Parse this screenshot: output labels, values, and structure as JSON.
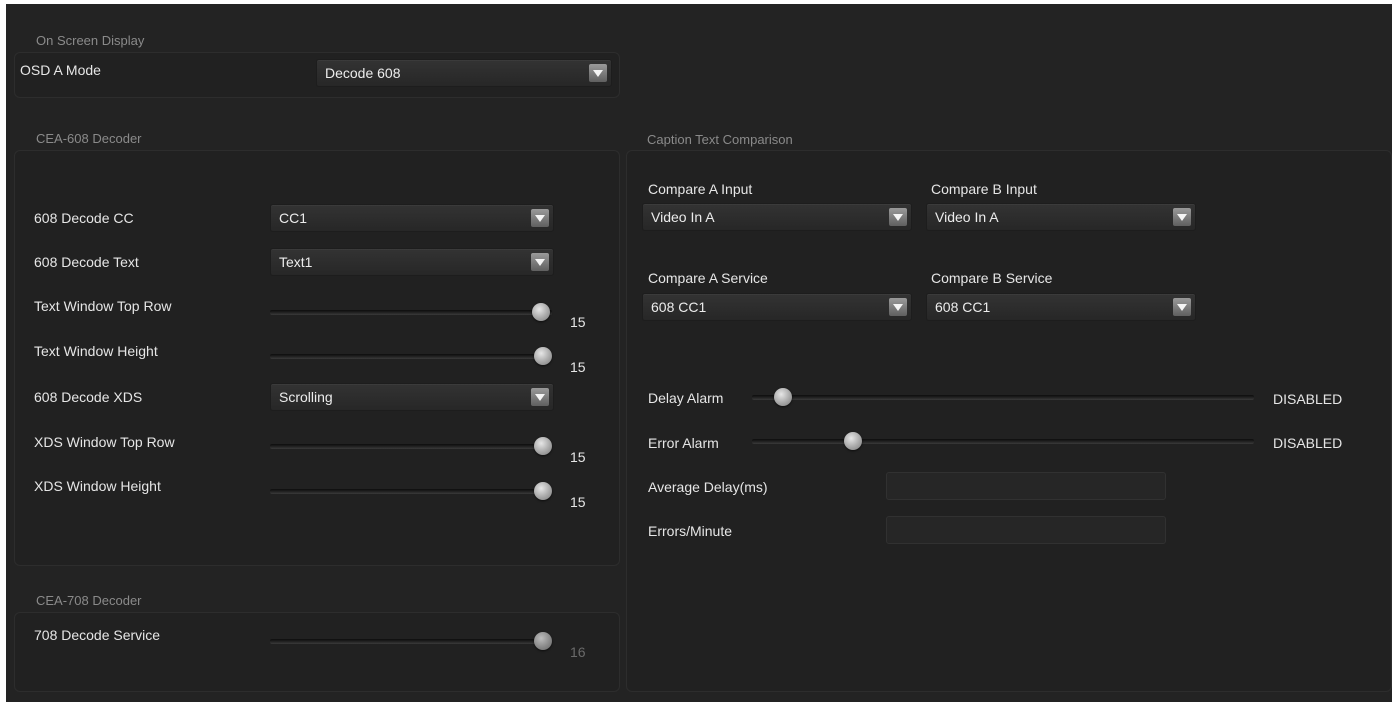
{
  "osd": {
    "title": "On Screen Display",
    "mode_label": "OSD A Mode",
    "mode_value": "Decode 608"
  },
  "cea608": {
    "title": "CEA-608 Decoder",
    "decode_cc_label": "608 Decode CC",
    "decode_cc_value": "CC1",
    "decode_text_label": "608 Decode Text",
    "decode_text_value": "Text1",
    "text_top_row_label": "Text Window Top Row",
    "text_top_row_value": "15",
    "text_height_label": "Text Window Height",
    "text_height_value": "15",
    "decode_xds_label": "608 Decode XDS",
    "decode_xds_value": "Scrolling",
    "xds_top_row_label": "XDS Window Top Row",
    "xds_top_row_value": "15",
    "xds_height_label": "XDS Window Height",
    "xds_height_value": "15"
  },
  "cea708": {
    "title": "CEA-708 Decoder",
    "decode_service_label": "708 Decode Service",
    "decode_service_value": "16"
  },
  "comparison": {
    "title": "Caption Text Comparison",
    "compare_a_input_label": "Compare A Input",
    "compare_a_input_value": "Video In A",
    "compare_b_input_label": "Compare B Input",
    "compare_b_input_value": "Video In A",
    "compare_a_service_label": "Compare A Service",
    "compare_a_service_value": "608 CC1",
    "compare_b_service_label": "Compare B Service",
    "compare_b_service_value": "608 CC1",
    "delay_alarm_label": "Delay Alarm",
    "delay_alarm_status": "DISABLED",
    "error_alarm_label": "Error Alarm",
    "error_alarm_status": "DISABLED",
    "average_delay_label": "Average Delay(ms)",
    "average_delay_value": "",
    "errors_per_minute_label": "Errors/Minute",
    "errors_per_minute_value": ""
  },
  "icons": {
    "dropdown": "chevron-down-icon"
  },
  "colors": {
    "background": "#232323",
    "panel": "#212121",
    "section_title": "#8a8a8a",
    "text": "#e6e6e6"
  }
}
